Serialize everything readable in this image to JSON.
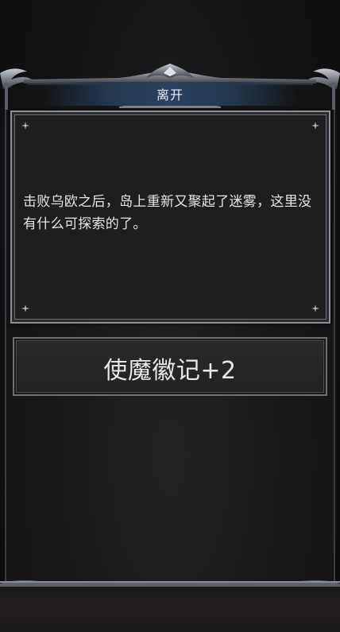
{
  "dialog": {
    "title": "离开",
    "message": "击败乌欧之后，岛上重新又聚起了迷雾，这里没有什么可探索的了。"
  },
  "options": [
    {
      "label": "使魔徽记+2"
    }
  ],
  "colors": {
    "title_bar": "#2a4360",
    "frame_metal": "#8c9096",
    "panel_bg": "#1e1e1f",
    "text": "#e6e6e6"
  },
  "icons": [
    "ornate-frame-icon",
    "corner-star-icon"
  ]
}
